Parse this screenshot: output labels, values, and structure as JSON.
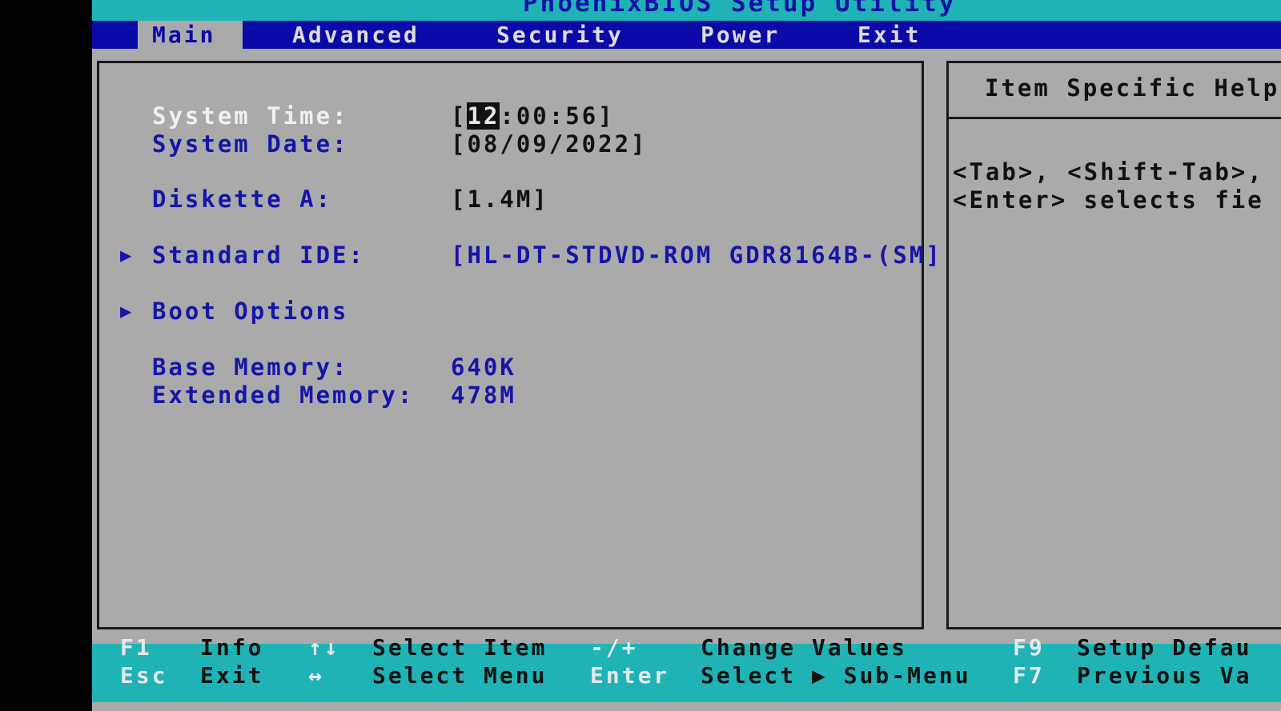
{
  "title": "PhoenixBIOS Setup Utility",
  "menu": [
    {
      "label": "Main"
    },
    {
      "label": "Advanced"
    },
    {
      "label": "Security"
    },
    {
      "label": "Power"
    },
    {
      "label": "Exit"
    }
  ],
  "fields": {
    "system_time": {
      "label": "System Time:",
      "bracket_open": "[",
      "hour": "12",
      "rest": ":00:56]"
    },
    "system_date": {
      "label": "System Date:",
      "value": "[08/09/2022]"
    },
    "diskette_a": {
      "label": "Diskette A:",
      "value": "[1.4M]"
    },
    "standard_ide": {
      "label": "Standard IDE:",
      "value": "[HL-DT-STDVD-ROM GDR8164B-(SM]"
    },
    "boot_options": {
      "label": "Boot Options"
    },
    "base_memory": {
      "label": "Base Memory:",
      "value": "640K"
    },
    "extended_memory": {
      "label": "Extended Memory:",
      "value": "478M"
    }
  },
  "submenu_marker": "▶",
  "help": {
    "title": "Item Specific Help",
    "line1": "<Tab>, <Shift-Tab>,",
    "line2": "<Enter> selects fie"
  },
  "footer": {
    "row1": [
      {
        "key": "F1",
        "desc": "Info"
      },
      {
        "key": "↑↓",
        "desc": "Select Item"
      },
      {
        "key": "-/+",
        "desc": "Change Values"
      },
      {
        "key": "F9",
        "desc": "Setup Defau"
      }
    ],
    "row2": [
      {
        "key": "Esc",
        "desc": "Exit"
      },
      {
        "key": "↔",
        "desc": "Select Menu"
      },
      {
        "key": "Enter",
        "desc": "Select ▶ Sub-Menu"
      },
      {
        "key": "F7",
        "desc": "Previous Va"
      }
    ]
  },
  "colors": {
    "menubar": "#0a0aa8",
    "titlebar": "#1fb3b5",
    "panel": "#aaaaaa",
    "label": "#1515a8"
  }
}
